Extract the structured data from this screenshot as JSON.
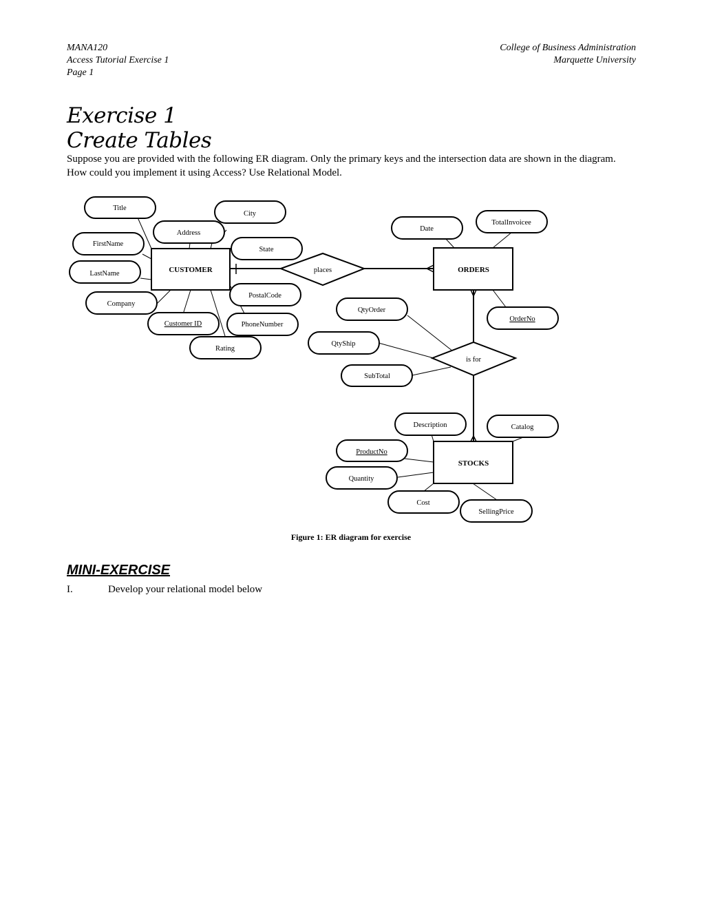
{
  "header": {
    "course": "MANA120",
    "document": "Access Tutorial Exercise 1",
    "page": "Page 1",
    "college": "College of Business Administration",
    "university": "Marquette University"
  },
  "title": {
    "line1": "Exercise 1",
    "line2": "Create Tables"
  },
  "intro": "Suppose you are provided with the following ER diagram. Only the primary keys and the intersection data are shown in the diagram. How could you implement it using Access?  Use Relational Model.",
  "diagram": {
    "entities": [
      {
        "id": "customer",
        "label": "CUSTOMER"
      },
      {
        "id": "orders",
        "label": "ORDERS"
      },
      {
        "id": "stocks",
        "label": "STOCKS"
      }
    ],
    "relationships": [
      {
        "id": "places",
        "label": "places",
        "from": "CUSTOMER",
        "to": "ORDERS",
        "cardinality": "one-to-many"
      },
      {
        "id": "isfor",
        "label": "is for",
        "from": "ORDERS",
        "to": "STOCKS",
        "cardinality": "many-to-many"
      }
    ],
    "attributes": [
      {
        "label": "Title",
        "of": "CUSTOMER",
        "key": false
      },
      {
        "label": "City",
        "of": "CUSTOMER",
        "key": false
      },
      {
        "label": "Address",
        "of": "CUSTOMER",
        "key": false
      },
      {
        "label": "FirstName",
        "of": "CUSTOMER",
        "key": false
      },
      {
        "label": "State",
        "of": "CUSTOMER",
        "key": false
      },
      {
        "label": "LastName",
        "of": "CUSTOMER",
        "key": false
      },
      {
        "label": "PostalCode",
        "of": "CUSTOMER",
        "key": false
      },
      {
        "label": "Company",
        "of": "CUSTOMER",
        "key": false
      },
      {
        "label": "Customer ID",
        "of": "CUSTOMER",
        "key": true
      },
      {
        "label": "PhoneNumber",
        "of": "CUSTOMER",
        "key": false
      },
      {
        "label": "Rating",
        "of": "CUSTOMER",
        "key": false
      },
      {
        "label": "Date",
        "of": "ORDERS",
        "key": false
      },
      {
        "label": "TotalInvoicee",
        "of": "ORDERS",
        "key": false
      },
      {
        "label": "OrderNo",
        "of": "ORDERS",
        "key": true
      },
      {
        "label": "QtyOrder",
        "of": "is for",
        "key": false
      },
      {
        "label": "QtyShip",
        "of": "is for",
        "key": false
      },
      {
        "label": "SubTotal",
        "of": "is for",
        "key": false
      },
      {
        "label": "Description",
        "of": "STOCKS",
        "key": false
      },
      {
        "label": "Catalog",
        "of": "STOCKS",
        "key": false
      },
      {
        "label": "ProductNo",
        "of": "STOCKS",
        "key": true
      },
      {
        "label": "Quantity",
        "of": "STOCKS",
        "key": false
      },
      {
        "label": "Cost",
        "of": "STOCKS",
        "key": false
      },
      {
        "label": "SellingPrice",
        "of": "STOCKS",
        "key": false
      }
    ]
  },
  "caption": "Figure 1: ER diagram for exercise",
  "mini_exercise": {
    "heading": "MINI-EXERCISE",
    "items": [
      {
        "number": "I.",
        "text": "Develop your relational model below"
      }
    ]
  }
}
